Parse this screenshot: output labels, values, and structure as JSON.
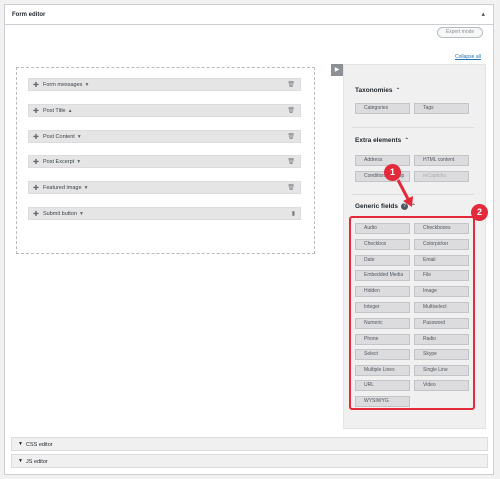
{
  "panel_title": "Form editor",
  "panel_toggle_icon": "chevron-up-icon",
  "expert_mode_label": "Expert mode",
  "collapse_all_label": "Collapse all",
  "form_fields": [
    {
      "label": "Form messages",
      "action_icon": "trash-icon"
    },
    {
      "label": "Post Title",
      "action_icon": "trash-icon"
    },
    {
      "label": "Post Content",
      "action_icon": "trash-icon"
    },
    {
      "label": "Post Excerpt",
      "action_icon": "trash-icon"
    },
    {
      "label": "Featured image",
      "action_icon": "trash-icon"
    },
    {
      "label": "Submit button",
      "action_icon": "lock-icon"
    }
  ],
  "sections": {
    "taxonomies": {
      "title": "Taxonomies",
      "buttons": [
        "Categories",
        "Tags"
      ]
    },
    "extra_elements": {
      "title": "Extra elements",
      "buttons": [
        "Address",
        "HTML content",
        "Conditional Group",
        "reCaptcha"
      ]
    },
    "generic_fields": {
      "title": "Generic fields",
      "buttons": [
        "Audio",
        "Checkboxes",
        "Checkbox",
        "Colorpicker",
        "Date",
        "Email",
        "Embedded Media",
        "File",
        "Hidden",
        "Image",
        "Integer",
        "Multiselect",
        "Numeric",
        "Password",
        "Phone",
        "Radio",
        "Select",
        "Skype",
        "Multiple Lines",
        "Single Line",
        "URL",
        "Video",
        "WYSIWYG"
      ]
    }
  },
  "annotations": {
    "one": "1",
    "two": "2"
  },
  "bottom_panels": {
    "css": "CSS editor",
    "js": "JS editor"
  },
  "colors": {
    "highlight": "#e4293b",
    "button_bg": "#dcdcde",
    "sidebar_bg": "#f0f0f1"
  }
}
